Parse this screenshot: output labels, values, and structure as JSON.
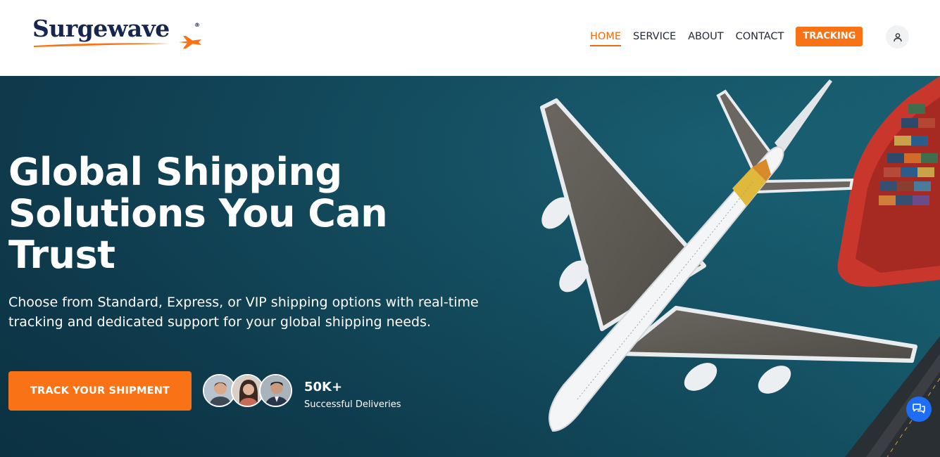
{
  "brand": {
    "name": "Surgewave",
    "reg_mark": "®",
    "text_color": "#16264f",
    "accent": "#f97316"
  },
  "nav": {
    "items": [
      {
        "label": "HOME",
        "active": true
      },
      {
        "label": "SERVICE",
        "active": false
      },
      {
        "label": "ABOUT",
        "active": false
      },
      {
        "label": "CONTACT",
        "active": false
      }
    ],
    "tracking_label": "TRACKING",
    "user_icon": "user-icon"
  },
  "hero": {
    "title": "Global Shipping Solutions You Can Trust",
    "subtitle": "Choose from Standard, Express, or VIP shipping options with real-time tracking and dedicated support for your global shipping needs.",
    "cta_label": "TRACK YOUR SHIPMENT",
    "stat_value": "50K+",
    "stat_label": "Successful Deliveries",
    "background": "aerial-airplane-and-cargo-ship",
    "avatars": [
      "customer-avatar",
      "customer-avatar",
      "customer-avatar"
    ]
  },
  "chat": {
    "icon": "chat-icon",
    "color": "#1d6ef5"
  }
}
